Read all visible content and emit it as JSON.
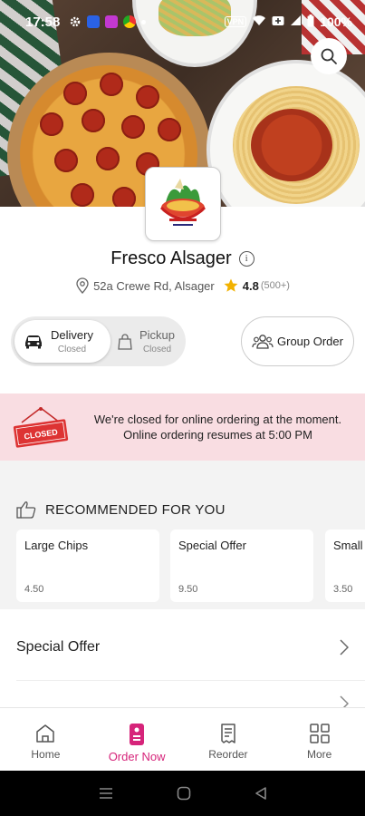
{
  "status_bar": {
    "time": "17:58",
    "battery": "100%",
    "vpn": "VPN"
  },
  "restaurant": {
    "name": "Fresco Alsager",
    "address": "52a Crewe Rd, Alsager",
    "rating": "4.8",
    "rating_count": "(500+)"
  },
  "order_modes": [
    {
      "label": "Delivery",
      "status": "Closed",
      "active": true
    },
    {
      "label": "Pickup",
      "status": "Closed",
      "active": false
    }
  ],
  "group_order_label": "Group Order",
  "closed_banner": {
    "badge": "CLOSED",
    "line1": "We're closed for online ordering at the moment.",
    "line2": "Online ordering resumes at 5:00 PM"
  },
  "recommended": {
    "heading": "RECOMMENDED FOR YOU",
    "items": [
      {
        "name": "Large Chips",
        "price": "4.50"
      },
      {
        "name": "Special Offer",
        "price": "9.50"
      },
      {
        "name": "Small",
        "price": "3.50"
      }
    ]
  },
  "categories": [
    {
      "label": "Special Offer"
    }
  ],
  "bottom_nav": [
    {
      "label": "Home",
      "icon": "home-icon"
    },
    {
      "label": "Order Now",
      "icon": "order-icon",
      "active": true
    },
    {
      "label": "Reorder",
      "icon": "receipt-icon"
    },
    {
      "label": "More",
      "icon": "grid-icon"
    }
  ],
  "colors": {
    "accent": "#d6247a",
    "banner_bg": "#f9dde2",
    "closed_badge": "#d33"
  }
}
